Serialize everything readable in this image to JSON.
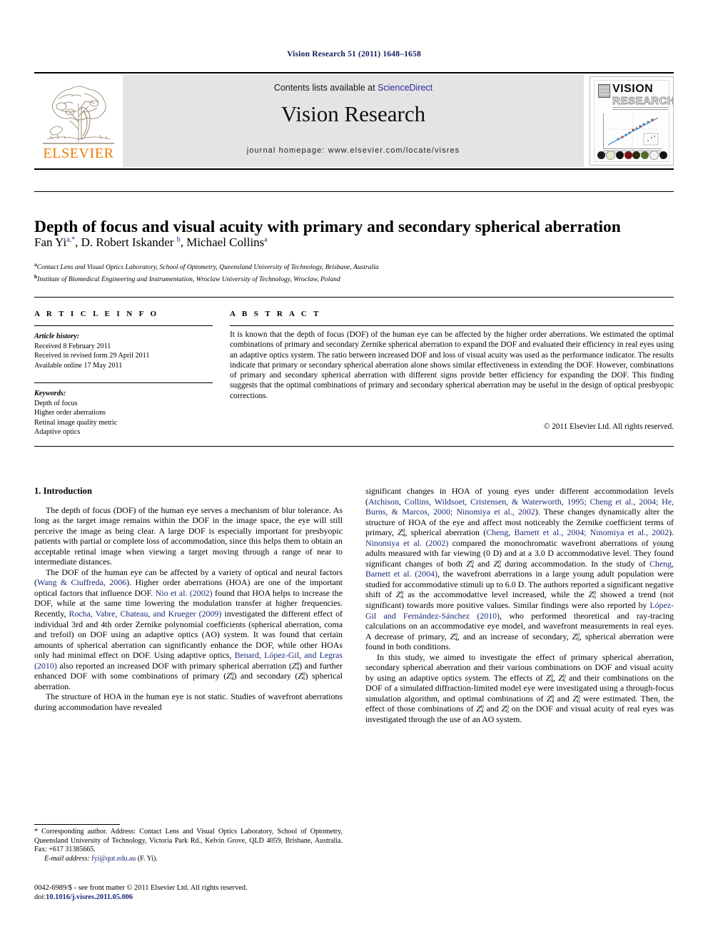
{
  "running_head": "Vision Research 51 (2011) 1648–1658",
  "masthead": {
    "contents_prefix": "Contents lists available at ",
    "sciencedirect": "ScienceDirect",
    "journal_title": "Vision Research",
    "homepage": "journal homepage: www.elsevier.com/locate/visres",
    "publisher_logo_word": "ELSEVIER",
    "cover": {
      "title_line1": "VISION",
      "title_line2": "RESEARCH"
    },
    "colors": {
      "elsevier_orange": "#f07d00",
      "band_grey": "#e4e4e4",
      "link_blue": "#2a2a9c"
    }
  },
  "article": {
    "title": "Depth of focus and visual acuity with primary and secondary spherical aberration",
    "authors": [
      {
        "name": "Fan Yi",
        "marks": "a,*"
      },
      {
        "name": "D. Robert Iskander",
        "marks": "b"
      },
      {
        "name": "Michael Collins",
        "marks": "a"
      }
    ],
    "affiliations": [
      {
        "mark": "a",
        "text": "Contact Lens and Visual Optics Laboratory, School of Optometry, Queensland University of Technology, Brisbane, Australia"
      },
      {
        "mark": "b",
        "text": "Institute of Biomedical Engineering and Instrumentation, Wroclaw University of Technology, Wroclaw, Poland"
      }
    ]
  },
  "info": {
    "heading": "A R T I C L E   I N F O",
    "history_label": "Article history:",
    "history": [
      "Received 8 February 2011",
      "Received in revised form 29 April 2011",
      "Available online 17 May 2011"
    ],
    "keywords_label": "Keywords:",
    "keywords": [
      "Depth of focus",
      "Higher order aberrations",
      "Retinal image quality metric",
      "Adaptive optics"
    ]
  },
  "abstract": {
    "heading": "A B S T R A C T",
    "text": "It is known that the depth of focus (DOF) of the human eye can be affected by the higher order aberrations. We estimated the optimal combinations of primary and secondary Zernike spherical aberration to expand the DOF and evaluated their efficiency in real eyes using an adaptive optics system. The ratio between increased DOF and loss of visual acuity was used as the performance indicator. The results indicate that primary or secondary spherical aberration alone shows similar effectiveness in extending the DOF. However, combinations of primary and secondary spherical aberration with different signs provide better efficiency for expanding the DOF. This finding suggests that the optimal combinations of primary and secondary spherical aberration may be useful in the design of optical presbyopic corrections.",
    "copyright": "© 2011 Elsevier Ltd. All rights reserved."
  },
  "body": {
    "section_heading": "1. Introduction",
    "left_paragraphs": [
      "The depth of focus (DOF) of the human eye serves a mechanism of blur tolerance. As long as the target image remains within the DOF in the image space, the eye will still perceive the image as being clear. A large DOF is especially important for presbyopic patients with partial or complete loss of accommodation, since this helps them to obtain an acceptable retinal image when viewing a target moving through a range of near to intermediate distances."
    ],
    "left_para2": {
      "seg1": "The DOF of the human eye can be affected by a variety of optical and neural factors (",
      "cite1": "Wang & Ciuffreda, 2006",
      "seg2": "). Higher order aberrations (HOA) are one of the important optical factors that influence DOF. ",
      "cite2": "Nio et al. (2002)",
      "seg3": " found that HOA helps to increase the DOF, while at the same time lowering the modulation transfer at higher frequencies. Recently, ",
      "cite3": "Rocha, Vabre, Chateau, and Krueger (2009)",
      "seg4": " investigated the different effect of individual 3rd and 4th order Zernike polynomial coefficients (spherical aberration, coma and trefoil) on DOF using an adaptive optics (AO) system. It was found that certain amounts of spherical aberration can significantly enhance the DOF, while other HOAs only had minimal effect on DOF. Using adaptive optics, ",
      "cite4": "Benard, López-Gil, and Legras (2010)",
      "seg5": " also reported an increased DOF with primary spherical aberration (",
      "z4a": "Z",
      "seg6": ") and further enhanced DOF with some combinations of primary (",
      "z4b": "Z",
      "seg7": ") and secondary (",
      "z6a": "Z",
      "seg8": ") spherical aberration."
    },
    "left_para3": "The structure of HOA in the human eye is not static. Studies of wavefront aberrations during accommodation have revealed",
    "right_para1": {
      "seg1": "significant changes in HOA of young eyes under different accommodation levels (",
      "cite1": "Atchison, Collins, Wildsoet, Cristensen, & Waterworth, 1995; Cheng et al., 2004; He, Burns, & Marcos, 2000; Ninomiya et al., 2002",
      "seg2": "). These changes dynamically alter the structure of HOA of the eye and affect most noticeably the Zernike coefficient terms of primary, ",
      "z1": "Z",
      "seg3": ", spherical aberration (",
      "cite2": "Cheng, Barnett et al., 2004; Ninomiya et al., 2002",
      "seg4": "). ",
      "cite3": "Ninomiya et al. (2002)",
      "seg5": " compared the monochromatic wavefront aberrations of young adults measured with far viewing (0 D) and at a 3.0 D accommodative level. They found significant changes of both ",
      "z2": "Z",
      "seg6": " and ",
      "z3": "Z",
      "seg7": " during accommodation. In the study of ",
      "cite4": "Cheng, Barnett et al. (2004)",
      "seg8": ", the wavefront aberrations in a large young adult population were studied for accommodative stimuli up to 6.0 D. The authors reported a significant negative shift of ",
      "z4": "Z",
      "seg9": " as the accommodative level increased, while the ",
      "z5": "Z",
      "seg10": " showed a trend (not significant) towards more positive values. Similar findings were also reported by ",
      "cite5": "López-Gil and Fernández-Sánchez (2010)",
      "seg11": ", who performed theoretical and ray-tracing calculations on an accommodative eye model, and wavefront measurements in real eyes. A decrease of primary, ",
      "z6": "Z",
      "seg12": ", and an increase of secondary, ",
      "z7": "Z",
      "seg13": ", spherical aberration were found in both conditions."
    },
    "right_para2": {
      "seg1": "In this study, we aimed to investigate the effect of primary spherical aberration, secondary spherical aberration and their various combinations on DOF and visual acuity by using an adaptive optics system. The effects of ",
      "z1": "Z",
      "seg2": ", ",
      "z2": "Z",
      "seg3": " and their combinations on the DOF of a simulated diffraction-limited model eye were investigated using a through-focus simulation algorithm, and optimal combinations of ",
      "z3": "Z",
      "seg4": " and ",
      "z4": "Z",
      "seg5": " were estimated. Then, the effect of those combinations of ",
      "z5": "Z",
      "seg6": " and ",
      "z6": "Z",
      "seg7": " on the DOF and visual acuity of real eyes was investigated through the use of an AO system."
    },
    "zernike": {
      "primary_sup": "0",
      "primary_sub": "4",
      "secondary_sup": "0",
      "secondary_sub": "6",
      "symbol": "Z"
    }
  },
  "footnote": {
    "corresponding": "* Corresponding author. Address: Contact Lens and Visual Optics Laboratory, School of Optometry, Queensland University of Technology, Victoria Park Rd., Kelvin Grove, QLD 4059, Brisbane, Australia. Fax: +617 31385665.",
    "email_label": "E-mail address:",
    "email": "fyi@qut.edu.au",
    "email_suffix": "(F. Yi)."
  },
  "imprint": {
    "line1": "0042-6989/$ - see front matter © 2011 Elsevier Ltd. All rights reserved.",
    "doi_label": "doi:",
    "doi_value": "10.1016/j.visres.2011.05.006"
  }
}
